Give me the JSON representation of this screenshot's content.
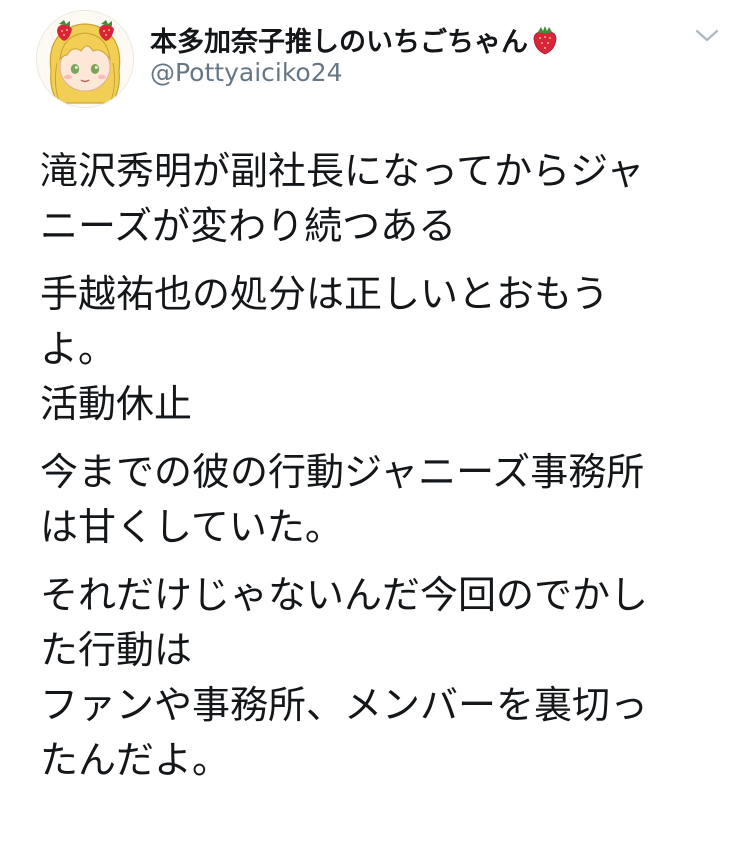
{
  "tweet": {
    "author": {
      "display_name": "本多加奈子推しのいちごちゃん",
      "display_name_emoji": "strawberry-emoji",
      "handle": "@Pottyaiciko24",
      "avatar": "avatar-illustration-girl-strawberry-hairclips"
    },
    "menu_icon": "chevron-down-icon",
    "paragraphs": [
      {
        "lines": [
          "滝沢秀明が副社長になってからジャ",
          "ニーズが変わり続つある"
        ]
      },
      {
        "lines": [
          "手越祐也の処分は正しいとおもう",
          "よ。",
          "活動休止"
        ]
      },
      {
        "lines": [
          "今までの彼の行動ジャニーズ事務所",
          "は甘くしていた。"
        ]
      },
      {
        "lines": [
          "それだけじゃないんだ今回のでかし",
          "た行動は",
          "ファンや事務所、メンバーを裏切っ",
          "たんだよ。"
        ]
      }
    ]
  },
  "colors": {
    "text_primary": "#14171a",
    "text_secondary": "#657786",
    "caret": "#aab8c2",
    "strawberry": "#d8253a"
  }
}
